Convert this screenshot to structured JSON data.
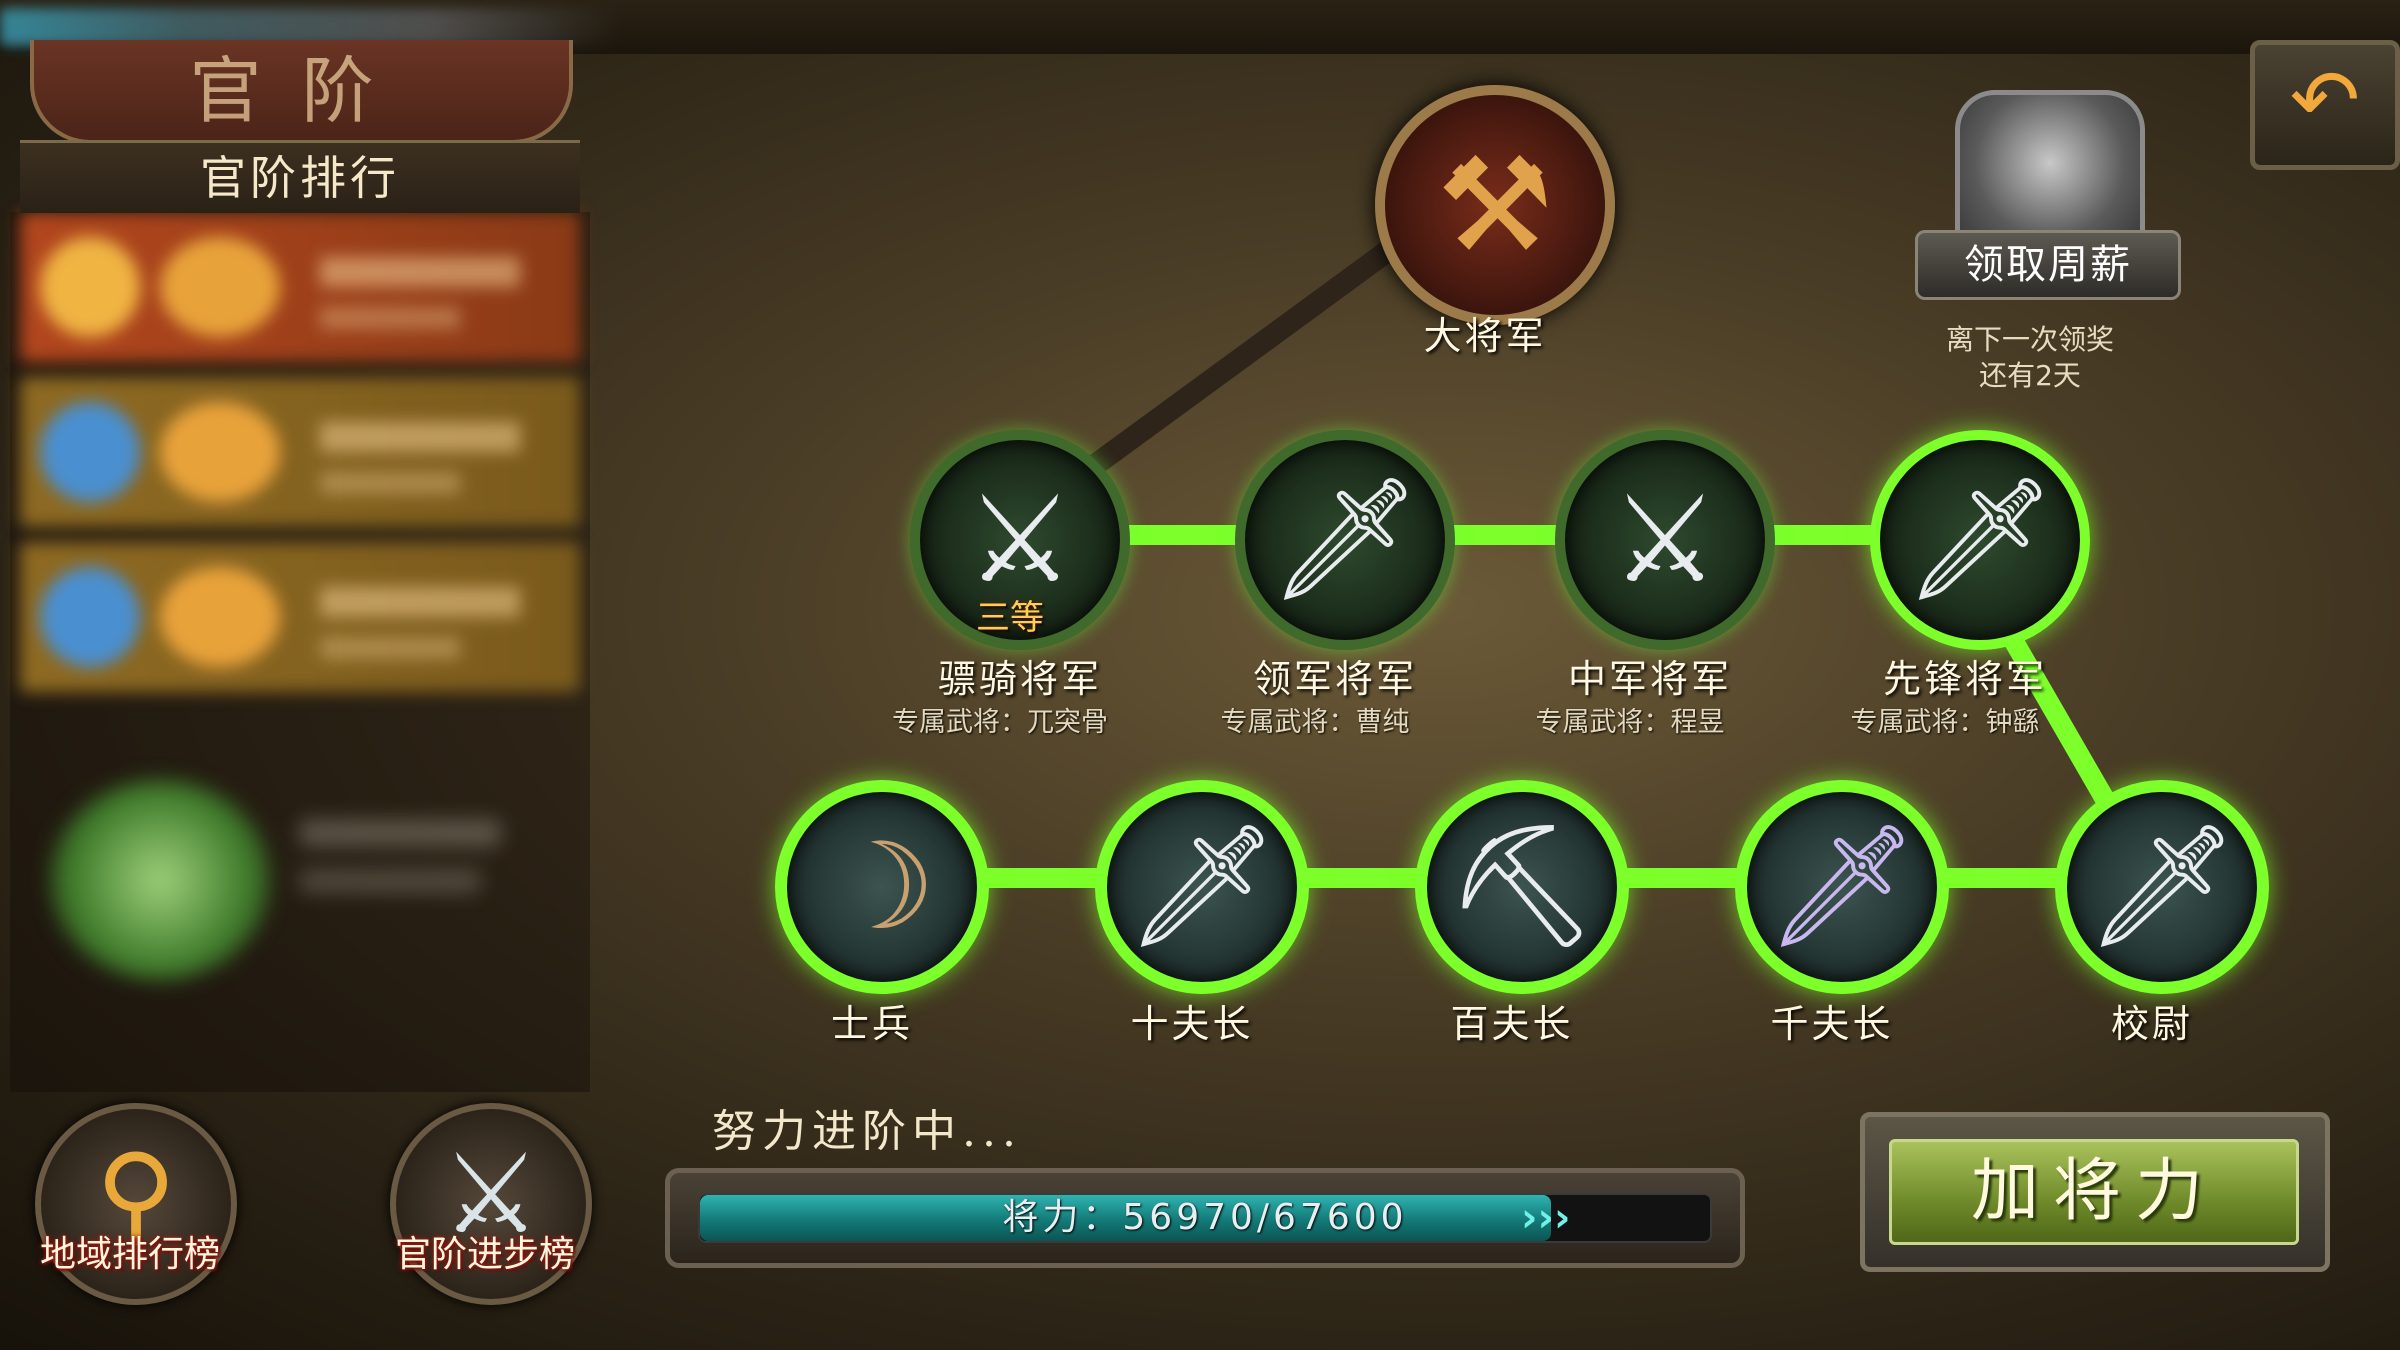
{
  "header": {
    "title": "官阶",
    "ranking_title": "官阶排行"
  },
  "buttons": {
    "regional_ranking": "地域排行榜",
    "rank_progress_ranking": "官阶进步榜",
    "add_power": "加将力"
  },
  "weekly_salary": {
    "label": "领取周薪",
    "next_reward_line1": "离下一次领奖",
    "next_reward_line2": "还有2天"
  },
  "ranks": {
    "top": {
      "name": "大将军"
    },
    "upper": [
      {
        "name": "骠骑将军",
        "exclusive": "专属武将：兀突骨",
        "badge": "三等"
      },
      {
        "name": "领军将军",
        "exclusive": "专属武将：曹纯"
      },
      {
        "name": "中军将军",
        "exclusive": "专属武将：程昱"
      },
      {
        "name": "先锋将军",
        "exclusive": "专属武将：钟繇"
      }
    ],
    "lower": [
      {
        "name": "士兵"
      },
      {
        "name": "十夫长"
      },
      {
        "name": "百夫长"
      },
      {
        "name": "千夫长"
      },
      {
        "name": "校尉"
      }
    ]
  },
  "progress": {
    "status": "努力进阶中...",
    "text": "将力：56970/67600",
    "current": 56970,
    "max": 67600
  },
  "colors": {
    "path_active": "#7cff2a",
    "path_inactive": "#3a2e22",
    "progress_fill": "#1f9c99",
    "button_green": "#8aa83e"
  }
}
